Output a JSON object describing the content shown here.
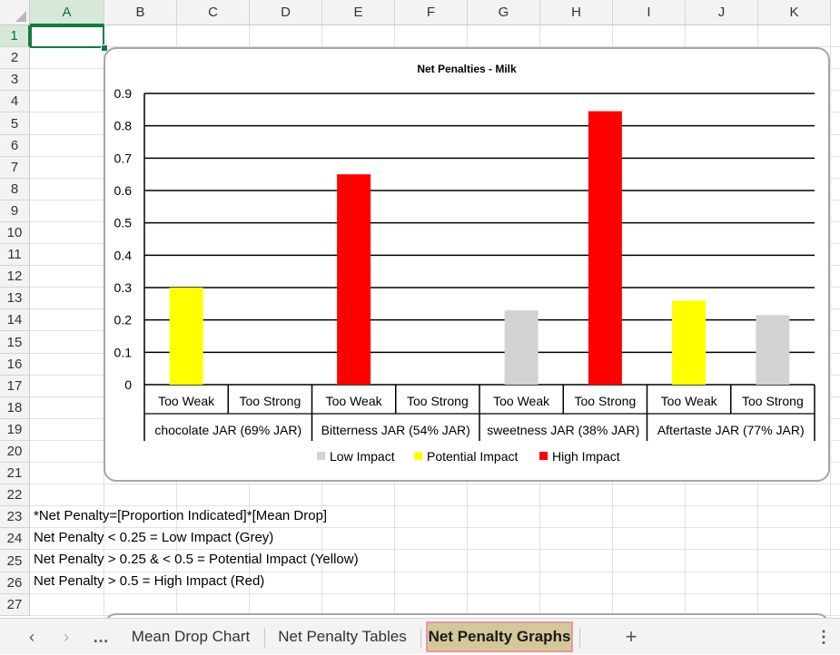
{
  "columns": [
    "A",
    "B",
    "C",
    "D",
    "E",
    "F",
    "G",
    "H",
    "I",
    "J",
    "K"
  ],
  "rows": [
    "1",
    "2",
    "3",
    "4",
    "5",
    "6",
    "7",
    "8",
    "9",
    "10",
    "11",
    "12",
    "13",
    "14",
    "15",
    "16",
    "17",
    "18",
    "19",
    "20",
    "21",
    "22",
    "23",
    "24",
    "25",
    "26",
    "27"
  ],
  "selected_cell": "A1",
  "notes": [
    "*Net Penalty=[Proportion Indicated]*[Mean Drop]",
    "Net Penalty < 0.25 = Low Impact (Grey)",
    "Net Penalty > 0.25 & < 0.5 = Potential Impact (Yellow)",
    "Net Penalty > 0.5 = High Impact (Red)"
  ],
  "chart_data": {
    "type": "bar",
    "title": "Net Penalties - Milk",
    "xlabel": "",
    "ylabel": "",
    "ylim": [
      0,
      0.9
    ],
    "yticks": [
      "0",
      "0.1",
      "0.2",
      "0.3",
      "0.4",
      "0.5",
      "0.6",
      "0.7",
      "0.8",
      "0.9"
    ],
    "grid": true,
    "legend_position": "bottom",
    "groups": [
      {
        "label": "chocolate JAR (69% JAR)",
        "categories": [
          "Too Weak",
          "Too Strong"
        ]
      },
      {
        "label": "Bitterness JAR (54% JAR)",
        "categories": [
          "Too Weak",
          "Too Strong"
        ]
      },
      {
        "label": "sweetness JAR (38% JAR)",
        "categories": [
          "Too Weak",
          "Too Strong"
        ]
      },
      {
        "label": "Aftertaste JAR (77% JAR)",
        "categories": [
          "Too Weak",
          "Too Strong"
        ]
      }
    ],
    "values": [
      0.3,
      null,
      0.65,
      null,
      0.23,
      0.845,
      0.26,
      0.215
    ],
    "impact": [
      "Potential Impact",
      null,
      "High Impact",
      null,
      "Low Impact",
      "High Impact",
      "Potential Impact",
      "Low Impact"
    ],
    "legend": [
      {
        "name": "Low Impact",
        "color": "#d3d3d3"
      },
      {
        "name": "Potential Impact",
        "color": "#ffff00"
      },
      {
        "name": "High Impact",
        "color": "#ff0000"
      }
    ]
  },
  "sheet_tabs": [
    {
      "label": "Mean Drop Chart",
      "active": false
    },
    {
      "label": "Net Penalty Tables",
      "active": false
    },
    {
      "label": "Net Penalty Graphs",
      "active": true
    }
  ],
  "icons": {
    "prev": "chevron-left-icon",
    "next": "chevron-right-icon",
    "more": "ellipsis-icon",
    "add": "plus-icon",
    "options": "vertical-ellipsis-icon"
  }
}
